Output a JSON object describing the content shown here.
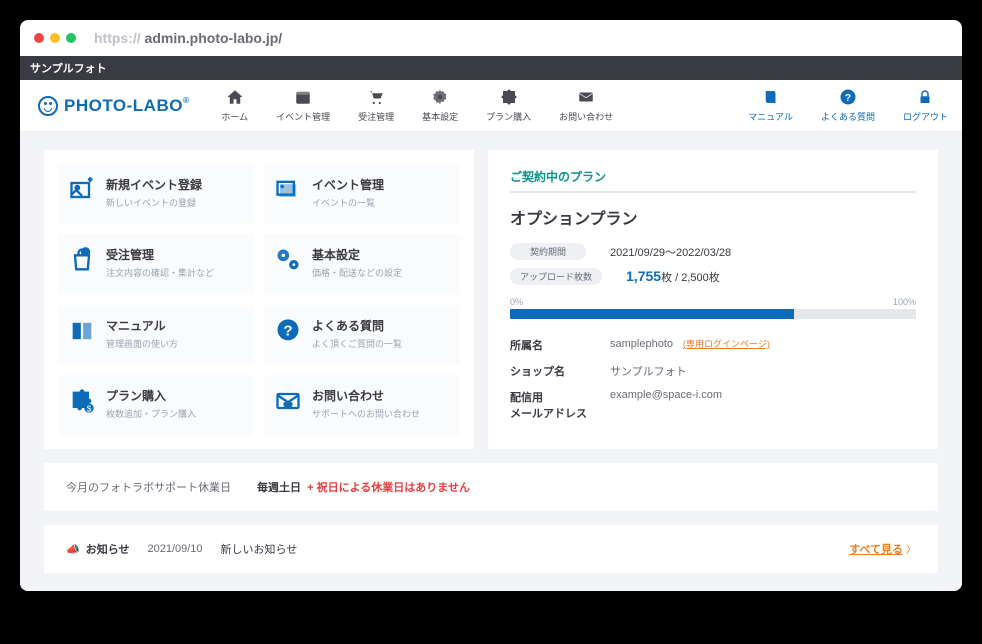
{
  "browser": {
    "url_prefix": "https:// ",
    "url_main": "admin.photo-labo.jp/"
  },
  "topbar": {
    "shop_name": "サンプルフォト"
  },
  "logo": {
    "text": "PHOTO-LABO"
  },
  "nav": {
    "main": [
      {
        "label": "ホーム"
      },
      {
        "label": "イベント管理"
      },
      {
        "label": "受注管理"
      },
      {
        "label": "基本設定"
      },
      {
        "label": "プラン購入"
      },
      {
        "label": "お問い合わせ"
      }
    ],
    "right": [
      {
        "label": "マニュアル"
      },
      {
        "label": "よくある質問"
      },
      {
        "label": "ログアウト"
      }
    ]
  },
  "cards": [
    {
      "title": "新規イベント登録",
      "sub": "新しいイベントの登録"
    },
    {
      "title": "イベント管理",
      "sub": "イベントの一覧"
    },
    {
      "title": "受注管理",
      "sub": "注文内容の確認・集計など"
    },
    {
      "title": "基本設定",
      "sub": "価格・配送などの設定"
    },
    {
      "title": "マニュアル",
      "sub": "管理画面の使い方"
    },
    {
      "title": "よくある質問",
      "sub": "よく頂くご質問の一覧"
    },
    {
      "title": "プラン購入",
      "sub": "枚数追加・プラン購入"
    },
    {
      "title": "お問い合わせ",
      "sub": "サポートへのお問い合わせ"
    }
  ],
  "plan": {
    "header": "ご契約中のプラン",
    "name": "オプションプラン",
    "period_label": "契約期間",
    "period_value": "2021/09/29～2022/03/28",
    "upload_label": "アップロード枚数",
    "upload_used": "1,755",
    "upload_unit1": "枚 / ",
    "upload_total": "2,500枚",
    "progress_min": "0%",
    "progress_max": "100%",
    "progress_percent": 70,
    "info": [
      {
        "label": "所属名",
        "value": "samplephoto",
        "link": "(専用ログインページ)"
      },
      {
        "label": "ショップ名",
        "value": "サンプルフォト"
      },
      {
        "label": "配信用\nメールアドレス",
        "value": "example@space-i.com"
      }
    ]
  },
  "support": {
    "label": "今月のフォトラボサポート休業日",
    "day": "毎週土日",
    "plus": "+",
    "note": "祝日による休業日はありません"
  },
  "news": {
    "title": "お知らせ",
    "date": "2021/09/10",
    "text": "新しいお知らせ",
    "all": "すべて見る"
  }
}
